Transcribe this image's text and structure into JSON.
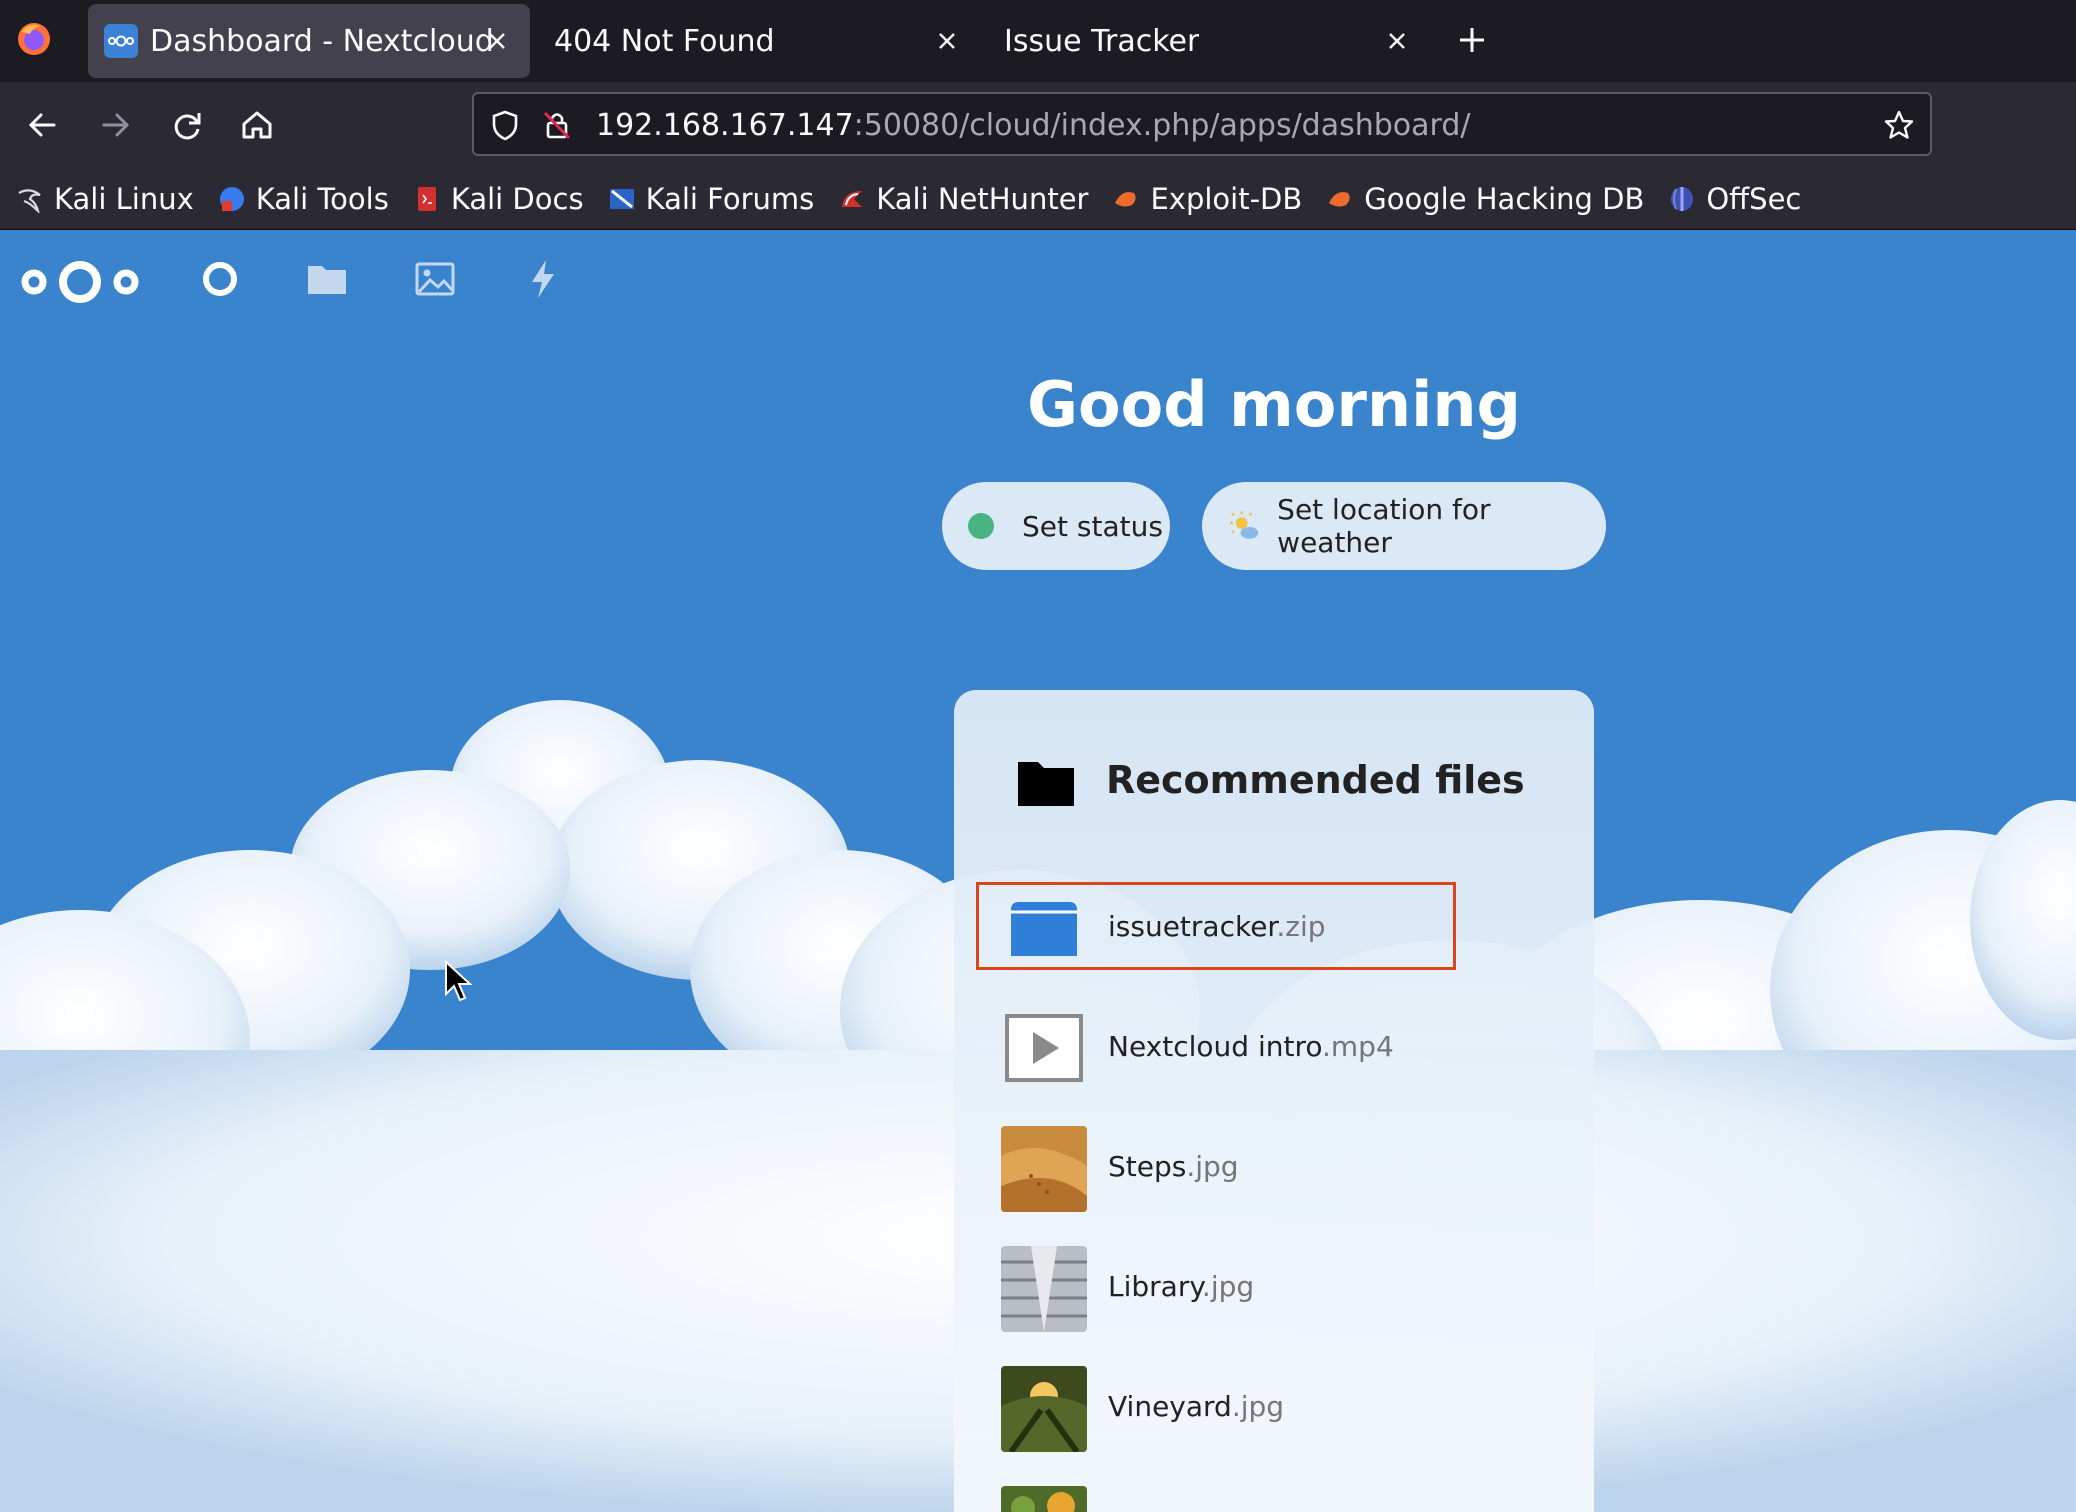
{
  "browser": {
    "tabs": [
      {
        "title": "Dashboard - Nextcloud",
        "active": true
      },
      {
        "title": "404 Not Found",
        "active": false
      },
      {
        "title": "Issue Tracker",
        "active": false
      }
    ],
    "url": {
      "host": "192.168.167.147",
      "rest": ":50080/cloud/index.php/apps/dashboard/"
    },
    "bookmarks": [
      {
        "label": "Kali Linux",
        "icon": "kali-dragon-icon"
      },
      {
        "label": "Kali Tools",
        "icon": "kali-tools-icon"
      },
      {
        "label": "Kali Docs",
        "icon": "kali-docs-icon"
      },
      {
        "label": "Kali Forums",
        "icon": "kali-forums-icon"
      },
      {
        "label": "Kali NetHunter",
        "icon": "kali-nethunter-icon"
      },
      {
        "label": "Exploit-DB",
        "icon": "exploit-db-icon"
      },
      {
        "label": "Google Hacking DB",
        "icon": "ghdb-icon"
      },
      {
        "label": "OffSec",
        "icon": "offsec-icon"
      }
    ]
  },
  "nextcloud": {
    "greeting": "Good morning",
    "status_button": "Set status",
    "weather_button": "Set location for weather",
    "widget": {
      "title": "Recommended files",
      "files": [
        {
          "name": "issuetracker",
          "ext": ".zip",
          "type": "archive"
        },
        {
          "name": "Nextcloud intro",
          "ext": ".mp4",
          "type": "video"
        },
        {
          "name": "Steps",
          "ext": ".jpg",
          "type": "image-desert"
        },
        {
          "name": "Library",
          "ext": ".jpg",
          "type": "image-library"
        },
        {
          "name": "Vineyard",
          "ext": ".jpg",
          "type": "image-vineyard"
        }
      ]
    }
  },
  "colors": {
    "background": "#3a83cd",
    "status_online": "#49b382",
    "highlight": "#d9461c"
  }
}
